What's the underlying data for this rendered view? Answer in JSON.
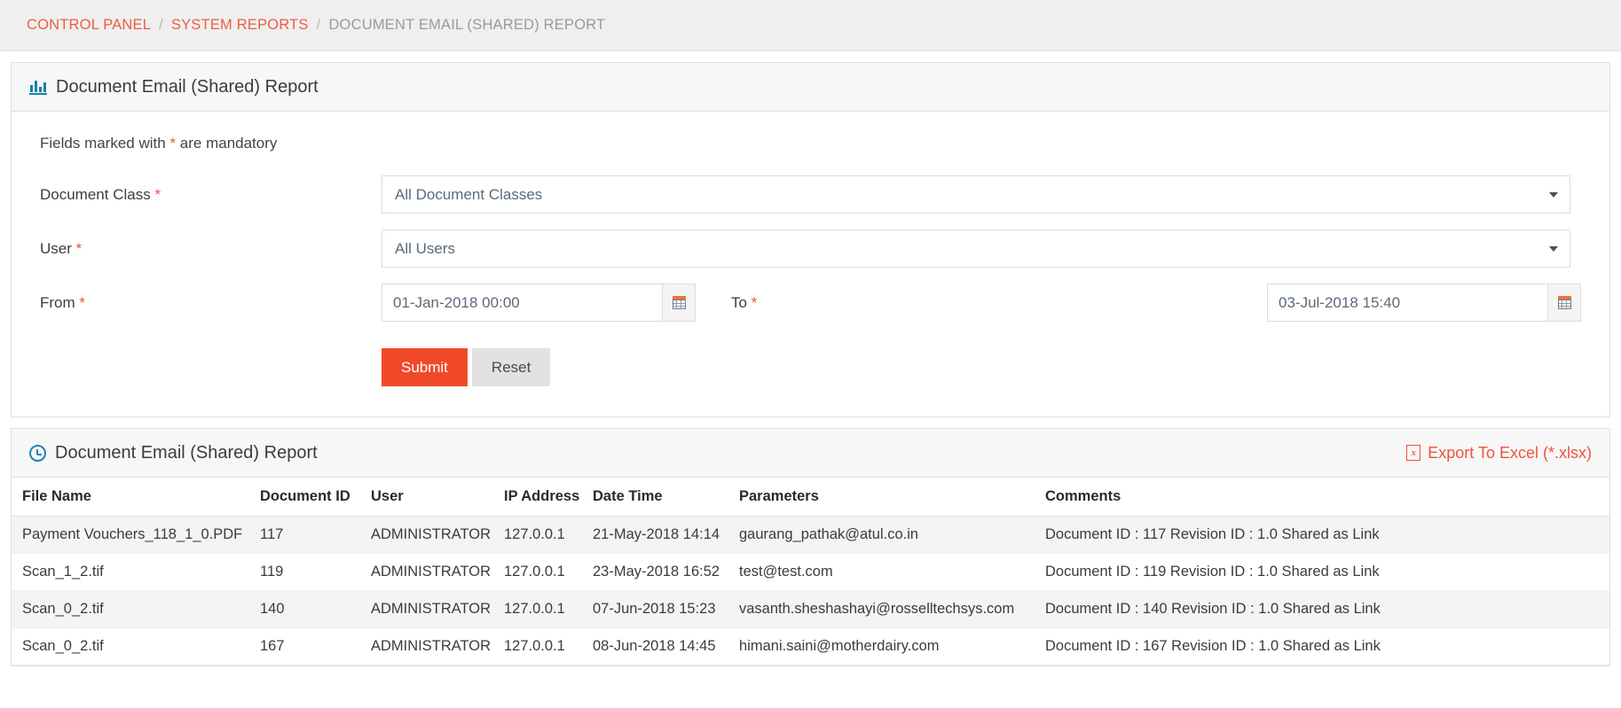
{
  "breadcrumb": {
    "items": [
      {
        "label": "CONTROL PANEL",
        "current": false
      },
      {
        "label": "SYSTEM REPORTS",
        "current": false
      },
      {
        "label": "DOCUMENT EMAIL (SHARED) REPORT",
        "current": true
      }
    ],
    "separator": "/"
  },
  "filter_panel": {
    "icon": "bar-chart-icon",
    "title": "Document Email (Shared) Report",
    "mandatory_note_before": "Fields marked with ",
    "mandatory_note_star": "*",
    "mandatory_note_after": " are mandatory",
    "fields": {
      "document_class": {
        "label": "Document Class",
        "required_marker": "*",
        "value": "All Document Classes",
        "options": [
          "All Document Classes"
        ]
      },
      "user": {
        "label": "User",
        "required_marker": "*",
        "value": "All Users",
        "options": [
          "All Users"
        ]
      },
      "from": {
        "label": "From",
        "required_marker": "*",
        "value": "01-Jan-2018 00:00",
        "icon": "calendar-icon"
      },
      "to": {
        "label": "To",
        "required_marker": "*",
        "value": "03-Jul-2018 15:40",
        "icon": "calendar-icon"
      }
    },
    "buttons": {
      "submit": "Submit",
      "reset": "Reset"
    }
  },
  "results_panel": {
    "icon": "clock-icon",
    "title": "Document Email (Shared) Report",
    "export": {
      "icon": "excel-file-icon",
      "icon_glyph": "x",
      "label": "Export To Excel (*.xlsx)"
    },
    "table": {
      "columns": [
        "File Name",
        "Document ID",
        "User",
        "IP Address",
        "Date Time",
        "Parameters",
        "Comments"
      ],
      "rows": [
        {
          "file_name": "Payment Vouchers_118_1_0.PDF",
          "document_id": "117",
          "user": "ADMINISTRATOR",
          "ip_address": "127.0.0.1",
          "date_time": "21-May-2018 14:14",
          "parameters": "gaurang_pathak@atul.co.in",
          "comments": "Document ID : 117 Revision ID : 1.0 Shared as Link"
        },
        {
          "file_name": "Scan_1_2.tif",
          "document_id": "119",
          "user": "ADMINISTRATOR",
          "ip_address": "127.0.0.1",
          "date_time": "23-May-2018 16:52",
          "parameters": "test@test.com",
          "comments": "Document ID : 119 Revision ID : 1.0 Shared as Link"
        },
        {
          "file_name": "Scan_0_2.tif",
          "document_id": "140",
          "user": "ADMINISTRATOR",
          "ip_address": "127.0.0.1",
          "date_time": "07-Jun-2018 15:23",
          "parameters": "vasanth.sheshashayi@rosselltechsys.com",
          "comments": "Document ID : 140 Revision ID : 1.0 Shared as Link"
        },
        {
          "file_name": "Scan_0_2.tif",
          "document_id": "167",
          "user": "ADMINISTRATOR",
          "ip_address": "127.0.0.1",
          "date_time": "08-Jun-2018 14:45",
          "parameters": "himani.saini@motherdairy.com",
          "comments": "Document ID : 167 Revision ID : 1.0 Shared as Link"
        }
      ]
    }
  },
  "colors": {
    "accent": "#f0523a",
    "submit": "#f0492a",
    "icon_blue": "#1a86b4",
    "breadcrumb_bg": "#efefef",
    "panel_head_bg": "#f7f7f7"
  }
}
